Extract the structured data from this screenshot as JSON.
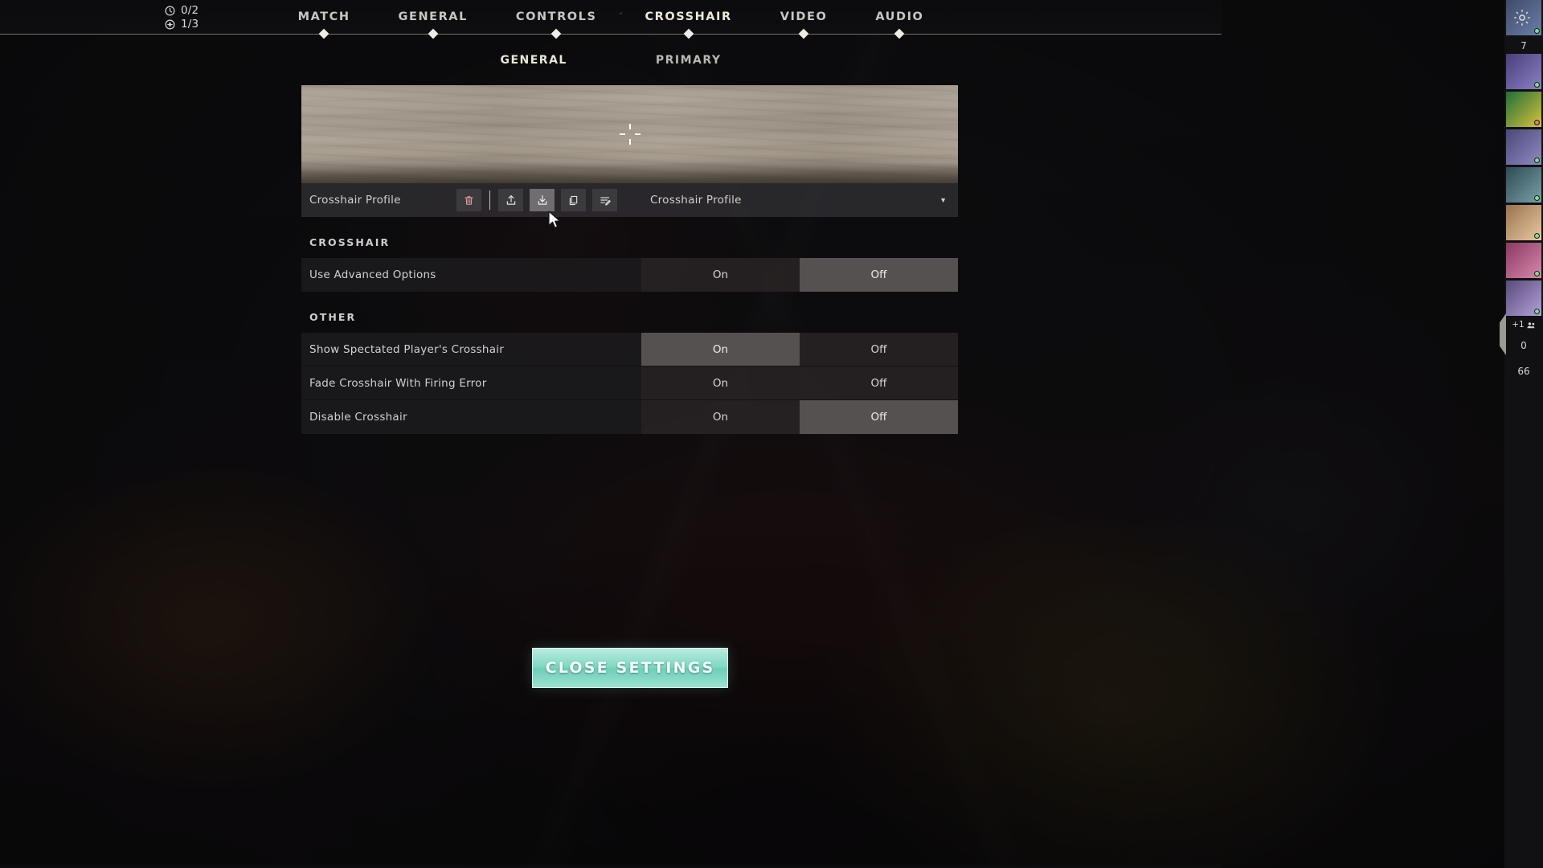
{
  "hud": {
    "round_counters": [
      {
        "icon": "clock-icon",
        "value": "0/2"
      },
      {
        "icon": "spike-icon",
        "value": "1/3"
      }
    ]
  },
  "main_tabs": [
    {
      "label": "MATCH",
      "active": false
    },
    {
      "label": "GENERAL",
      "active": false
    },
    {
      "label": "CONTROLS",
      "active": false,
      "caret": "ˇ"
    },
    {
      "label": "CROSSHAIR",
      "active": true
    },
    {
      "label": "VIDEO",
      "active": false
    },
    {
      "label": "AUDIO",
      "active": false
    }
  ],
  "gear_icon": "gear-icon",
  "sub_tabs": [
    {
      "label": "GENERAL",
      "active": true
    },
    {
      "label": "PRIMARY",
      "active": false
    }
  ],
  "preview": {
    "name": "crosshair-preview",
    "crosshair_style": "cross-4-line"
  },
  "profile": {
    "label": "Crosshair Profile",
    "dropdown_value": "Crosshair Profile",
    "dropdown_caret": "▼",
    "actions": [
      {
        "name": "delete-profile-button",
        "icon": "trash-icon",
        "variant": "danger",
        "hovered": false
      },
      {
        "name": "import-profile-button",
        "icon": "upload-icon",
        "variant": "normal",
        "hovered": false
      },
      {
        "name": "export-profile-button",
        "icon": "download-icon",
        "variant": "normal",
        "hovered": true
      },
      {
        "name": "duplicate-profile-button",
        "icon": "copy-icon",
        "variant": "normal",
        "hovered": false
      },
      {
        "name": "rename-profile-button",
        "icon": "edit-list-icon",
        "variant": "normal",
        "hovered": false
      }
    ]
  },
  "sections": [
    {
      "header": "CROSSHAIR",
      "rows": [
        {
          "label": "Use Advanced Options",
          "options": [
            {
              "label": "On",
              "selected": false
            },
            {
              "label": "Off",
              "selected": true
            }
          ]
        }
      ]
    },
    {
      "header": "OTHER",
      "rows": [
        {
          "label": "Show Spectated Player's Crosshair",
          "options": [
            {
              "label": "On",
              "selected": true
            },
            {
              "label": "Off",
              "selected": false
            }
          ]
        },
        {
          "label": "Fade Crosshair With Firing Error",
          "options": [
            {
              "label": "On",
              "selected": false
            },
            {
              "label": "Off",
              "selected": false
            }
          ]
        },
        {
          "label": "Disable Crosshair",
          "options": [
            {
              "label": "On",
              "selected": false
            },
            {
              "label": "Off",
              "selected": true
            }
          ]
        }
      ]
    }
  ],
  "close_settings_label": "CLOSE SETTINGS",
  "sidebar": {
    "avatars": [
      {
        "name": "player-avatar-1",
        "color1": "#3e4a6a",
        "color2": "#6b7fa6",
        "dot": "#7fe08a"
      },
      {
        "name": "player-avatar-2",
        "color1": "#4a3f7a",
        "color2": "#8a7fc4",
        "dot": "#7fe08a"
      },
      {
        "name": "player-avatar-3",
        "color1": "#1f6e3a",
        "color2": "#d8c23a",
        "dot": "#e07f7f"
      },
      {
        "name": "player-avatar-4",
        "color1": "#4b4878",
        "color2": "#8f8ac2",
        "dot": "#7fe08a"
      },
      {
        "name": "player-avatar-5",
        "color1": "#2e4a52",
        "color2": "#7aa0a8",
        "dot": "#7fe08a"
      },
      {
        "name": "player-avatar-6",
        "color1": "#9a7250",
        "color2": "#e8c9a0",
        "dot": "#7fe08a"
      },
      {
        "name": "player-avatar-7",
        "color1": "#8a3a62",
        "color2": "#d888ab",
        "dot": "#7fe08a"
      },
      {
        "name": "player-avatar-8",
        "color1": "#5a4a7a",
        "color2": "#b0a0d8",
        "dot": "#7fe08a"
      }
    ],
    "number_between_avatars": "7",
    "overflow_badge": "+1",
    "overflow_icon": "people-icon",
    "counters": [
      "0",
      "66"
    ]
  }
}
